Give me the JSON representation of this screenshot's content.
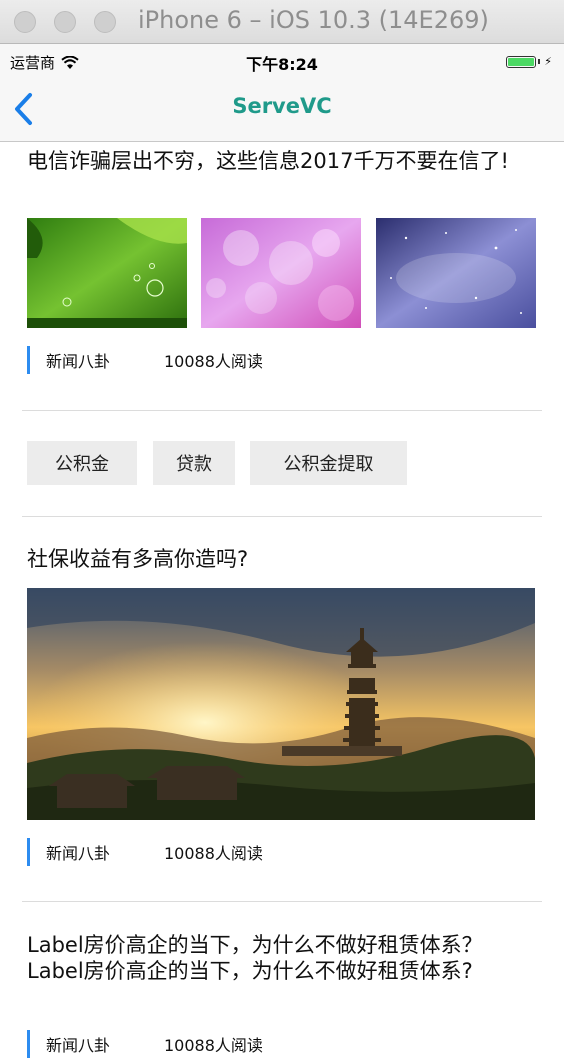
{
  "window": {
    "title": "iPhone 6 – iOS 10.3 (14E269)"
  },
  "status_bar": {
    "carrier": "运营商",
    "time": "下午8:24"
  },
  "nav": {
    "title": "ServeVC",
    "title_color": "#1f9a8a",
    "back_icon": "chevron-left-icon"
  },
  "articles": [
    {
      "title": "电信诈骗层出不穷，这些信息2017千万不要在信了!",
      "category": "新闻八卦",
      "reads": "10088人阅读"
    },
    {
      "title": "社保收益有多高你造吗?",
      "category": "新闻八卦",
      "reads": "10088人阅读"
    },
    {
      "title": "Label房价高企的当下，为什么不做好租赁体系？Label房价高企的当下，为什么不做好租赁体系?",
      "category": "新闻八卦",
      "reads": "10088人阅读"
    }
  ],
  "tags": [
    "公积金",
    "贷款",
    "公积金提取"
  ],
  "colors": {
    "accent_bar": "#2d8cf0",
    "battery": "#4cd964"
  }
}
